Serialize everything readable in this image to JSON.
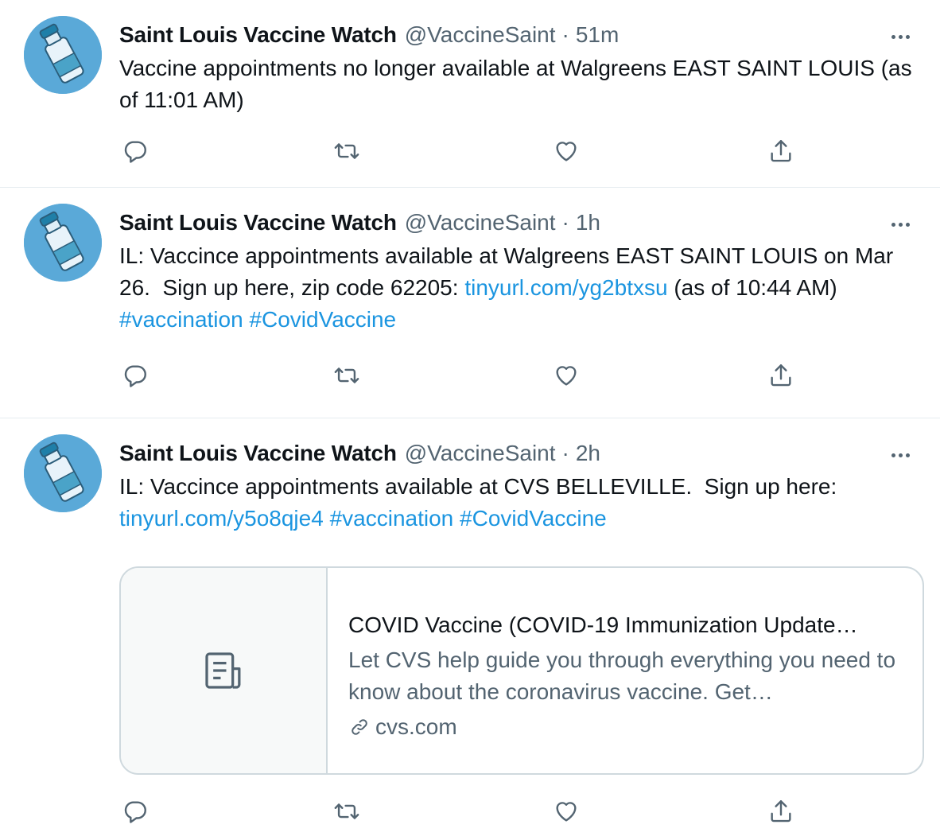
{
  "author": {
    "name": "Saint Louis Vaccine Watch",
    "handle": "@VaccineSaint"
  },
  "tweets": [
    {
      "time": "51m",
      "segments": [
        {
          "type": "text",
          "text": "Vaccine appointments no longer available at Walgreens EAST SAINT LOUIS (as of 11:01 AM)"
        }
      ]
    },
    {
      "time": "1h",
      "segments": [
        {
          "type": "text",
          "text": "IL: Vaccince appointments available at Walgreens EAST SAINT LOUIS on Mar 26.  Sign up here, zip code 62205: "
        },
        {
          "type": "link",
          "text": "tinyurl.com/yg2btxsu"
        },
        {
          "type": "text",
          "text": " (as of 10:44 AM) "
        },
        {
          "type": "link",
          "text": "#vaccination"
        },
        {
          "type": "text",
          "text": " "
        },
        {
          "type": "link",
          "text": "#CovidVaccine"
        }
      ]
    },
    {
      "time": "2h",
      "segments": [
        {
          "type": "text",
          "text": "IL: Vaccince appointments available at CVS BELLEVILLE.  Sign up here: "
        },
        {
          "type": "link",
          "text": "tinyurl.com/y5o8qje4"
        },
        {
          "type": "text",
          "text": " "
        },
        {
          "type": "link",
          "text": "#vaccination"
        },
        {
          "type": "text",
          "text": " "
        },
        {
          "type": "link",
          "text": "#CovidVaccine"
        }
      ],
      "card": {
        "title": "COVID Vaccine (COVID-19 Immunization Update…",
        "description": "Let CVS help guide you through everything you need to know about the coronavirus vaccine. Get…",
        "domain": "cvs.com"
      }
    }
  ],
  "icons": {
    "reply": "reply-icon",
    "retweet": "retweet-icon",
    "like": "like-icon",
    "share": "share-icon",
    "more": "more-icon",
    "card_media": "document-icon",
    "card_domain": "link-icon"
  },
  "colors": {
    "link": "#1b95e0",
    "secondary_text": "#536471",
    "border": "#e6ecf0"
  }
}
